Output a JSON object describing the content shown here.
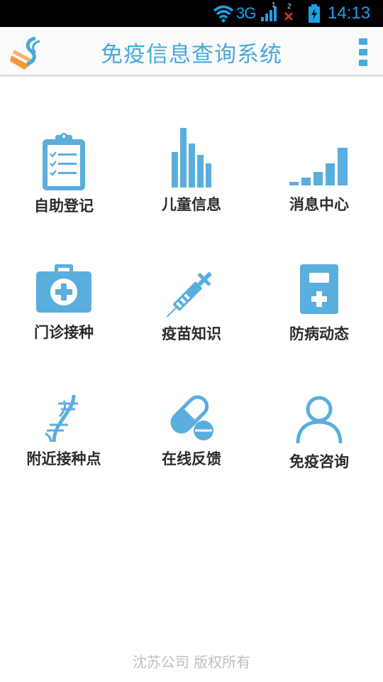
{
  "status_bar": {
    "network": "3G",
    "time": "14:13",
    "sim1_label": "1",
    "sim2_label": "2"
  },
  "app_bar": {
    "title": "免疫信息查询系统",
    "logo_icon": "app-logo-icon",
    "menu_icon": "overflow-menu-icon"
  },
  "menu_items": [
    {
      "label": "自助登记",
      "icon": "clipboard-checklist-icon"
    },
    {
      "label": "儿童信息",
      "icon": "bar-chart-icon"
    },
    {
      "label": "消息中心",
      "icon": "signal-bars-icon"
    },
    {
      "label": "门诊接种",
      "icon": "medical-kit-icon"
    },
    {
      "label": "疫苗知识",
      "icon": "syringe-icon"
    },
    {
      "label": "防病动态",
      "icon": "phone-plus-icon"
    },
    {
      "label": "附近接种点",
      "icon": "dna-icon"
    },
    {
      "label": "在线反馈",
      "icon": "pill-icon"
    },
    {
      "label": "免疫咨询",
      "icon": "user-icon"
    }
  ],
  "footer": {
    "copyright": "沈苏公司 版权所有"
  },
  "colors": {
    "accent": "#47a9dc",
    "icon": "#5aaede",
    "logo_orange": "#f29a3b",
    "status_icons": "#1ea0e6",
    "footer_text": "#bdbdbd",
    "label_text": "#2b2b2b"
  }
}
